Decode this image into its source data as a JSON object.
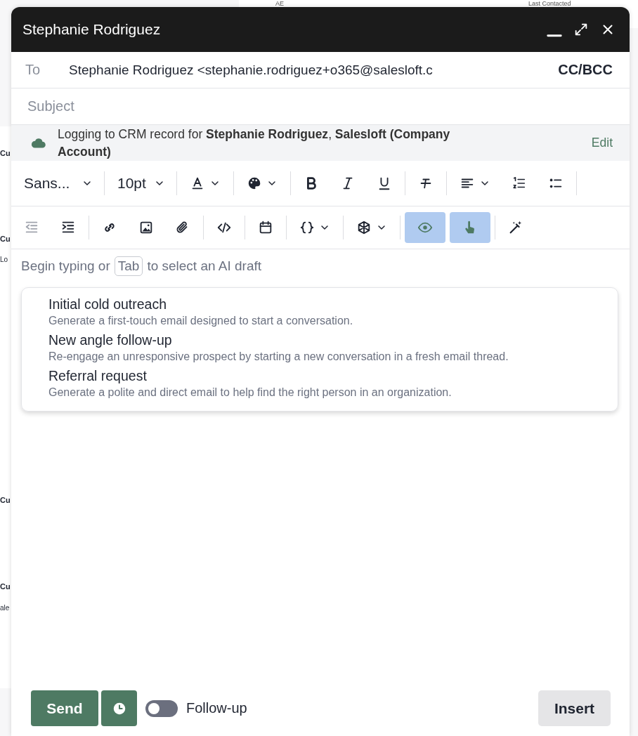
{
  "background": {
    "header_texts": [
      "AE",
      "Last Contacted"
    ],
    "side_texts": [
      "Cu",
      "Cu",
      "Lo",
      "Cu",
      "Cu",
      "ale"
    ]
  },
  "window": {
    "title": "Stephanie Rodriguez"
  },
  "to": {
    "label": "To",
    "value": "Stephanie Rodriguez <stephanie.rodriguez+o365@salesloft.c",
    "cc_bcc": "CC/BCC"
  },
  "subject": {
    "placeholder": "Subject"
  },
  "crm_notice": {
    "text": "Logging to CRM record for **Stephanie Rodriguez**, **Salesloft (Company Account)**",
    "action": "Edit"
  },
  "toolbar": {
    "font": "Sans...",
    "size": "10pt",
    "view_toggles": [
      {
        "selected": true
      },
      {
        "selected": true
      }
    ]
  },
  "prompt": {
    "before": "Begin typing or",
    "key": "Tab",
    "after": "to select an AI draft"
  },
  "drafts": [
    {
      "title": "Initial cold outreach",
      "description": "Generate a first-touch email designed to start a conversation."
    },
    {
      "title": "New angle follow-up",
      "description": "Re-engage an unresponsive prospect by starting a new conversation in a fresh email thread."
    },
    {
      "title": "Referral request",
      "description": "Generate a polite and direct email to help find the right person in an organization."
    }
  ],
  "footer": {
    "send": "Send",
    "follow_up": {
      "label": "Follow-up",
      "on": false
    },
    "insert": "Insert"
  }
}
